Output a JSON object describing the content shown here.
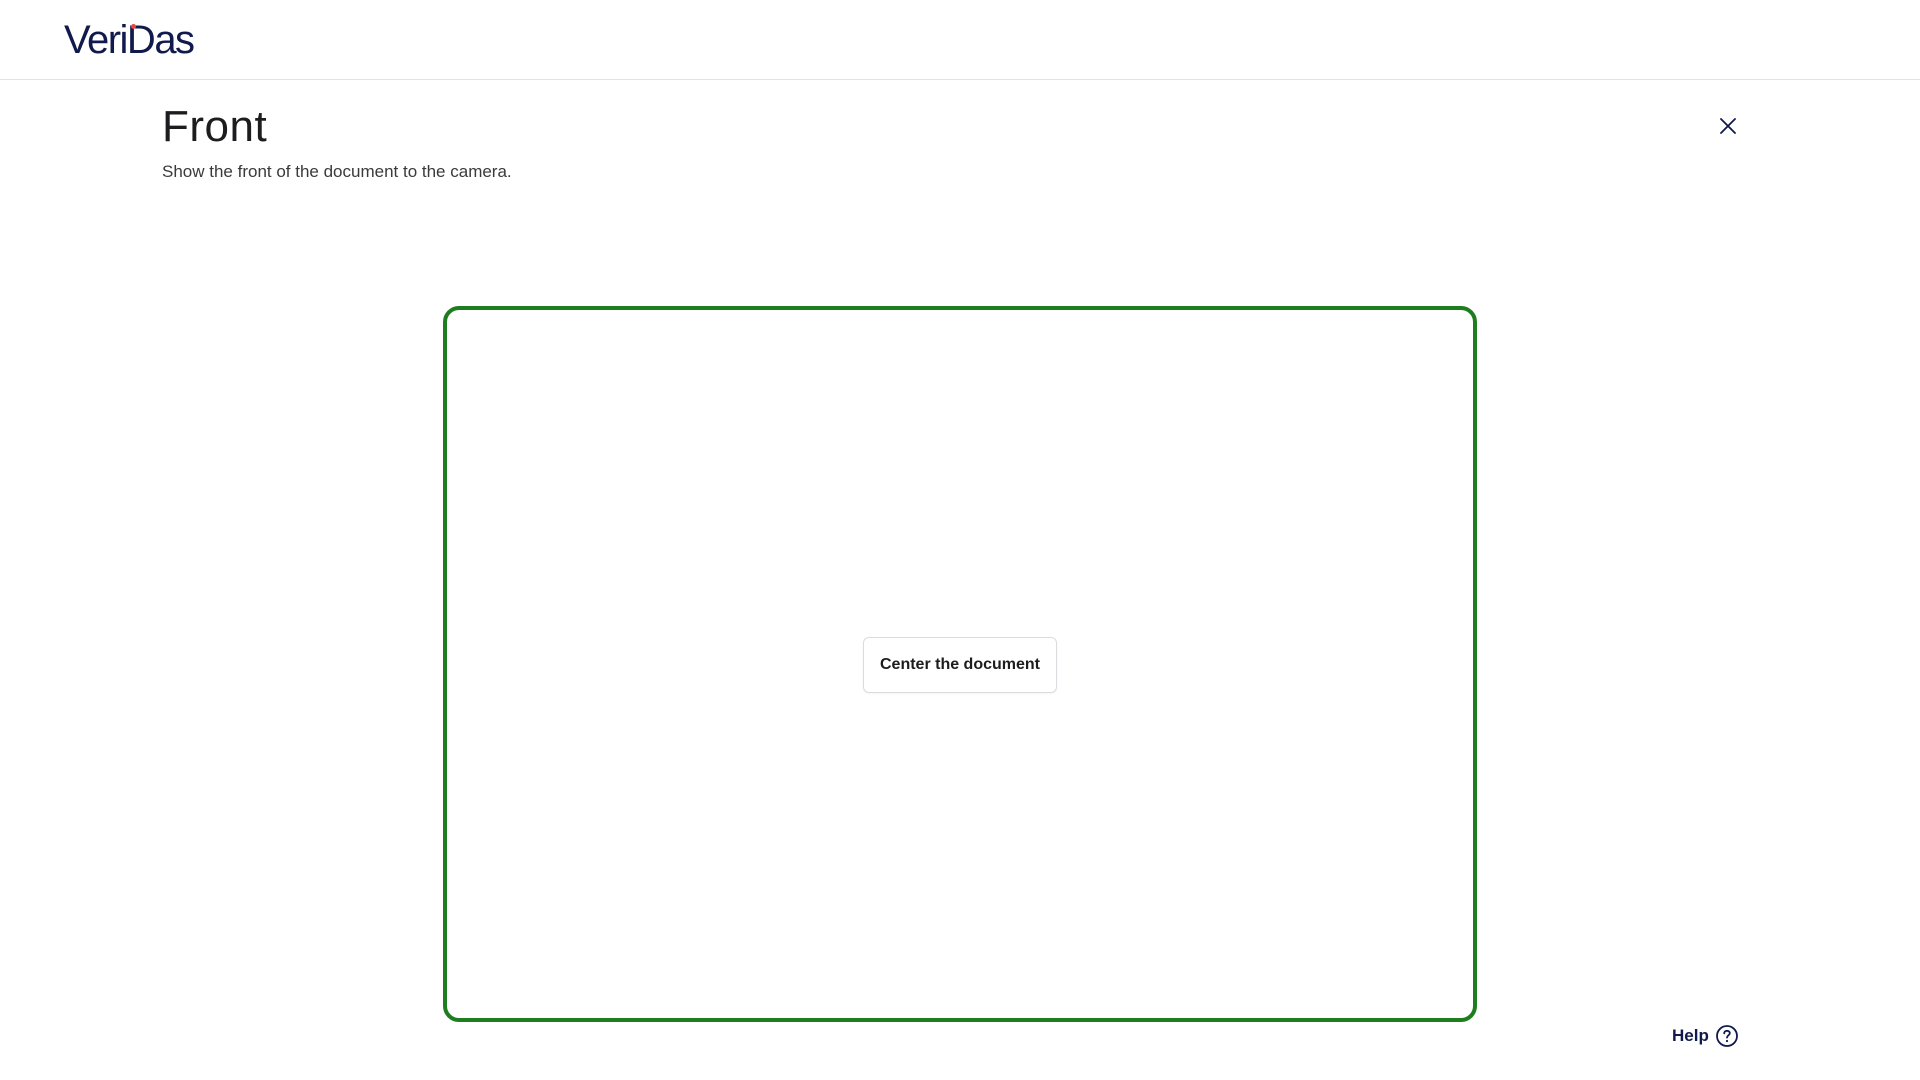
{
  "brand": {
    "name": "VeriDas",
    "logo_color": "#111a4d",
    "logo_accent": "#e8473f"
  },
  "step": {
    "title": "Front",
    "instruction": "Show the front of the document to the camera."
  },
  "camera": {
    "frame_color": "#1e7d1e",
    "status_message": "Center the document"
  },
  "actions": {
    "close_icon": "close-icon",
    "help_label": "Help",
    "help_icon": "question-circle-icon"
  }
}
